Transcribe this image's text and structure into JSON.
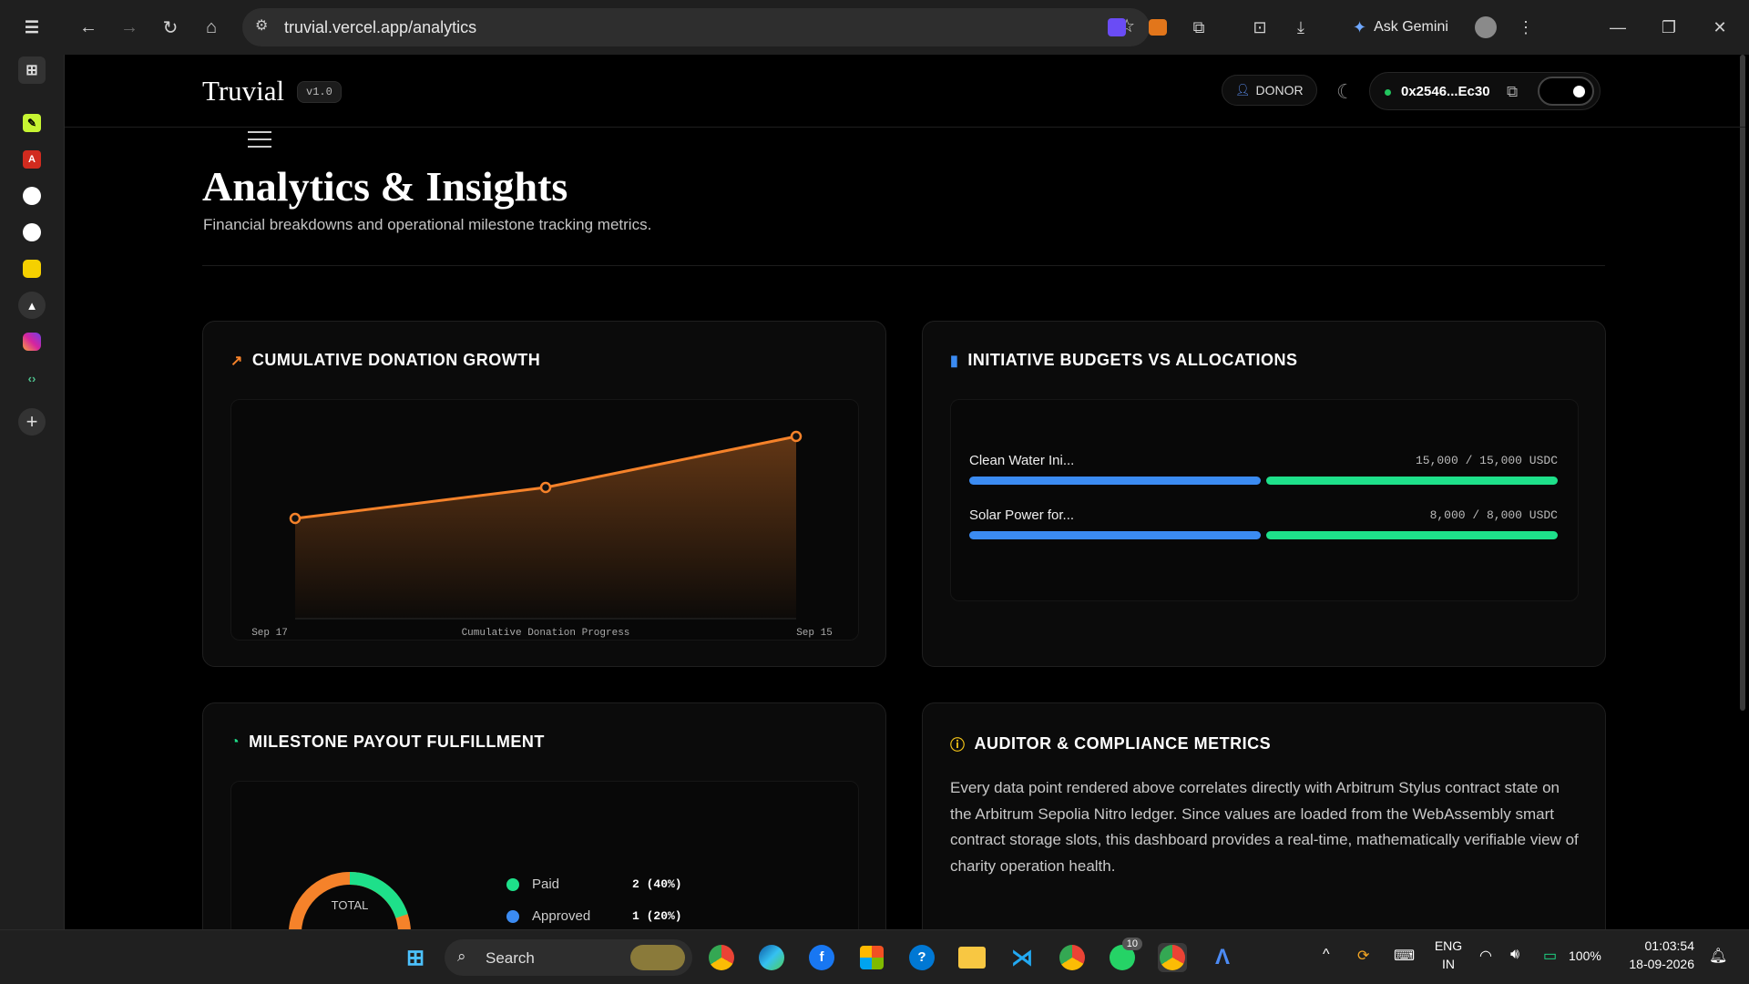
{
  "browser": {
    "url": "truvial.vercel.app/analytics",
    "assistant_label": "Ask Gemini"
  },
  "app": {
    "logo": "Truvial",
    "version": "v1.0",
    "role": "DONOR",
    "wallet_address": "0x2546...Ec30"
  },
  "page": {
    "title": "Analytics & Insights",
    "subtitle": "Financial breakdowns and operational milestone tracking metrics."
  },
  "growth_card": {
    "title": "CUMULATIVE DONATION GROWTH",
    "accent": "#f5822a"
  },
  "chart_data": {
    "type": "area",
    "x": [
      "Sep 17",
      "",
      "Sep 15"
    ],
    "xlabel": "Cumulative Donation Progress",
    "series": [
      {
        "values": [
          55,
          72,
          100
        ]
      }
    ],
    "ylim": [
      0,
      110
    ],
    "grid": false
  },
  "budgets_card": {
    "title": "INITIATIVE BUDGETS VS ALLOCATIONS",
    "items": [
      {
        "name": "Clean Water Ini...",
        "amount": "15,000 / 15,000 USDC",
        "budget": 15000,
        "allocated": 15000
      },
      {
        "name": "Solar Power for...",
        "amount": "8,000 / 8,000 USDC",
        "budget": 8000,
        "allocated": 8000
      }
    ],
    "colors": {
      "budget": "#3b8bf2",
      "allocated": "#1ee08a"
    }
  },
  "milestone_card": {
    "title": "MILESTONE PAYOUT FULFILLMENT",
    "donut_label": "TOTAL",
    "legend": [
      {
        "label": "Paid",
        "value": "2 (40%)",
        "color": "#1ee08a"
      },
      {
        "label": "Approved",
        "value": "1 (20%)",
        "color": "#3b8bf2"
      }
    ]
  },
  "auditor_card": {
    "title": "AUDITOR & COMPLIANCE METRICS",
    "text": "Every data point rendered above correlates directly with Arbitrum Stylus contract state on the Arbitrum Sepolia Nitro ledger. Since values are loaded from the WebAssembly smart contract storage slots, this dashboard provides a real-time, mathematically verifiable view of charity operation health."
  },
  "taskbar": {
    "search_label": "Search",
    "whatsapp_badge": "10",
    "lang_top": "ENG",
    "lang_bottom": "IN",
    "battery": "100%",
    "time": "01:03:54",
    "date": "18-09-2026"
  }
}
